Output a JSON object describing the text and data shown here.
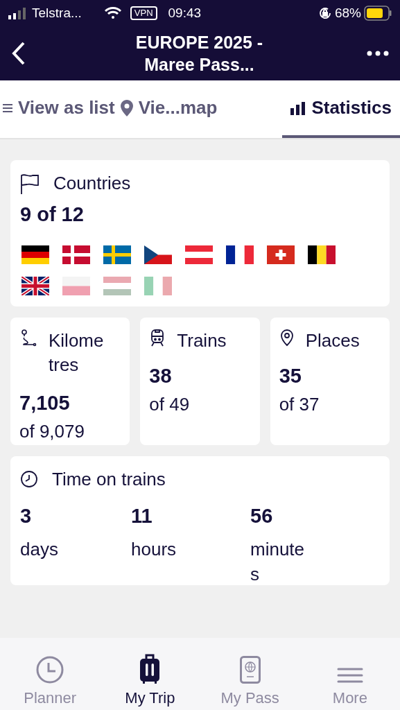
{
  "status_bar": {
    "carrier": "Telstra...",
    "vpn": "VPN",
    "time": "09:43",
    "battery": "68%"
  },
  "header": {
    "title": "EUROPE 2025 - Maree Pass..."
  },
  "tabs": [
    {
      "label": "View as list",
      "kind": "list",
      "selected": false
    },
    {
      "label": "Vie...map",
      "kind": "pin",
      "selected": false
    },
    {
      "label": "Statistics",
      "kind": "chart",
      "selected": true
    }
  ],
  "countries": {
    "title": "Countries",
    "count": "9 of 12",
    "flags": [
      {
        "kind": "germany",
        "visited": true
      },
      {
        "kind": "denmark",
        "visited": true
      },
      {
        "kind": "sweden",
        "visited": true
      },
      {
        "kind": "czechia",
        "visited": true
      },
      {
        "kind": "austria",
        "visited": true
      },
      {
        "kind": "france",
        "visited": true
      },
      {
        "kind": "switzerland",
        "visited": true
      },
      {
        "kind": "belgium",
        "visited": true
      },
      {
        "kind": "uk",
        "visited": true
      },
      {
        "kind": "poland",
        "visited": false
      },
      {
        "kind": "hungary",
        "visited": false
      },
      {
        "kind": "italy",
        "visited": false
      }
    ]
  },
  "stats": [
    {
      "kind": "route",
      "title": "Kilometres",
      "value": "7,105",
      "total": "of 9,079"
    },
    {
      "kind": "train",
      "title": "Trains",
      "value": "38",
      "total": "of 49"
    },
    {
      "kind": "pin",
      "title": "Places",
      "value": "35",
      "total": "of 37"
    }
  ],
  "time_on_trains": {
    "title": "Time on trains",
    "parts": [
      {
        "value": "3",
        "unit": "days"
      },
      {
        "value": "11",
        "unit": "hours"
      },
      {
        "value": "56",
        "unit": "minutes"
      }
    ]
  },
  "bottom_nav": [
    {
      "label": "Planner",
      "kind": "clock",
      "selected": false
    },
    {
      "label": "My Trip",
      "kind": "suitcase",
      "selected": true
    },
    {
      "label": "My Pass",
      "kind": "passport",
      "selected": false
    },
    {
      "label": "More",
      "kind": "menu",
      "selected": false
    }
  ]
}
